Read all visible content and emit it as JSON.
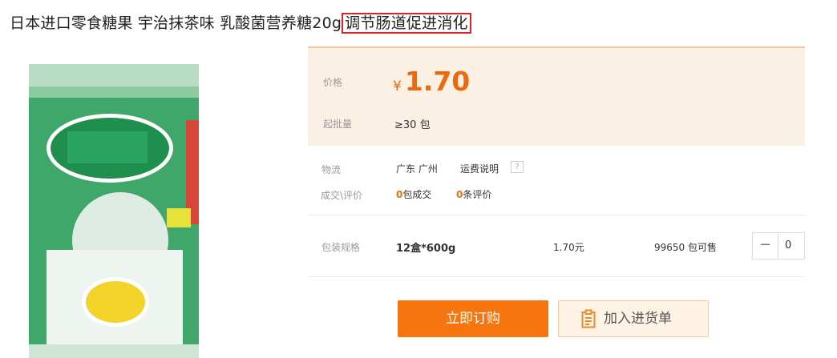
{
  "product": {
    "title": "日本进口零食糖果 宇治抹茶味 乳酸菌营养糖20g",
    "title_highlight": "调节肠道促进消化"
  },
  "price_section": {
    "price_label": "价格",
    "currency": "¥",
    "price": "1.70",
    "moq_label": "起批量",
    "moq": "≥30 包"
  },
  "logistics": {
    "label": "物流",
    "location": "广东 广州",
    "shipping_link": "运费说明",
    "help_icon": "?"
  },
  "stats": {
    "label": "成交\\评价",
    "deals_count": "0",
    "deals_text": "包成交",
    "reviews_count": "0",
    "reviews_text": "条评价"
  },
  "spec": {
    "label": "包装规格",
    "name": "12盒*600g",
    "price": "1.70元",
    "stock": "99650 包可售",
    "minus": "−",
    "quantity": "0"
  },
  "actions": {
    "buy_label": "立即订购",
    "cart_label": "加入进货单"
  },
  "icons": {
    "help": "question-icon",
    "cart": "clipboard-icon"
  },
  "colors": {
    "accent": "#f6750e",
    "price": "#ea6a10",
    "highlight_border": "#d8232a",
    "price_bg": "#fbf0e4"
  }
}
